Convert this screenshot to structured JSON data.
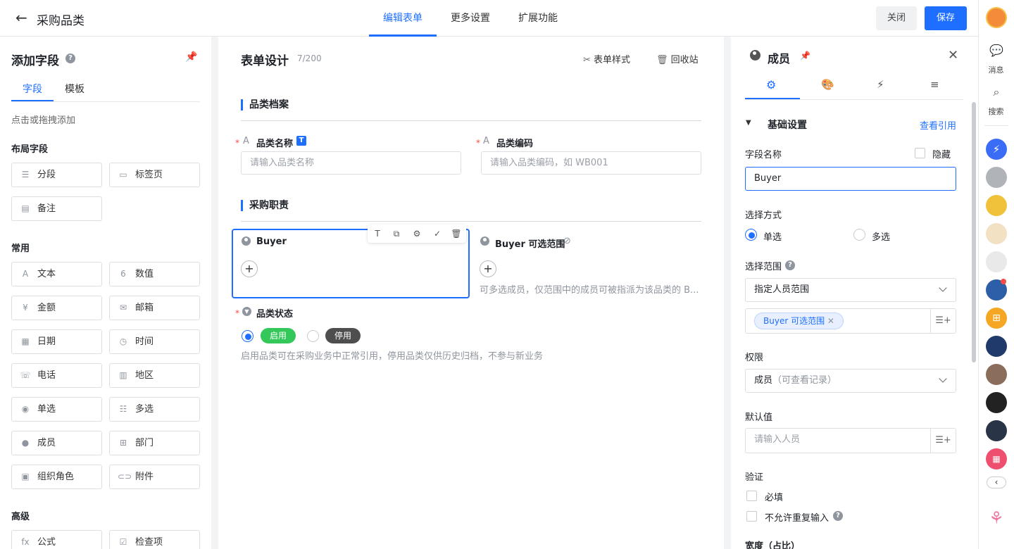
{
  "header": {
    "title": "采购品类",
    "tabs": [
      "编辑表单",
      "更多设置",
      "扩展功能"
    ],
    "close": "关闭",
    "save": "保存"
  },
  "left": {
    "title": "添加字段",
    "tabs": [
      "字段",
      "模板"
    ],
    "hint": "点击或拖拽添加",
    "layout_title": "布局字段",
    "layout_fields": [
      {
        "label": "分段",
        "icon": "section-icon"
      },
      {
        "label": "标签页",
        "icon": "tab-icon"
      },
      {
        "label": "备注",
        "icon": "note-icon"
      }
    ],
    "common_title": "常用",
    "common_fields": [
      {
        "label": "文本",
        "icon": "text-icon"
      },
      {
        "label": "数值",
        "icon": "number-icon"
      },
      {
        "label": "金额",
        "icon": "money-icon"
      },
      {
        "label": "邮箱",
        "icon": "mail-icon"
      },
      {
        "label": "日期",
        "icon": "calendar-icon"
      },
      {
        "label": "时间",
        "icon": "clock-icon"
      },
      {
        "label": "电话",
        "icon": "phone-icon"
      },
      {
        "label": "地区",
        "icon": "map-icon"
      },
      {
        "label": "单选",
        "icon": "single-select-icon"
      },
      {
        "label": "多选",
        "icon": "multi-select-icon"
      },
      {
        "label": "成员",
        "icon": "member-icon"
      },
      {
        "label": "部门",
        "icon": "department-icon"
      },
      {
        "label": "组织角色",
        "icon": "role-icon"
      },
      {
        "label": "附件",
        "icon": "attachment-icon"
      }
    ],
    "advanced_title": "高级",
    "advanced_fields": [
      {
        "label": "公式",
        "icon": "formula-icon"
      },
      {
        "label": "检查项",
        "icon": "checkbox-icon"
      }
    ]
  },
  "center": {
    "title": "表单设计",
    "count": "7/200",
    "tools": [
      "表单样式",
      "回收站"
    ],
    "section1": "品类档案",
    "f_name_label": "品类名称",
    "f_name_badge": "T",
    "f_name_placeholder": "请输入品类名称",
    "f_code_label": "品类编码",
    "f_code_placeholder": "请输入品类编码，如 WB001",
    "section2": "采购职责",
    "buyer_label": "Buyer",
    "scope_label": "Buyer 可选范围",
    "scope_desc": "可多选成员，仅范围中的成员可被指派为该品类的 B...",
    "status_label": "品类状态",
    "status_on": "启用",
    "status_off": "停用",
    "status_desc": "启用品类可在采购业务中正常引用，停用品类仅供历史归档，不参与新业务",
    "colors": {
      "accent": "#1e6fff",
      "on": "#34c759",
      "off": "#4e4e4e"
    }
  },
  "right": {
    "title": "成员",
    "basic": "基础设置",
    "refs": "查看引用",
    "field_name_label": "字段名称",
    "hide": "隐藏",
    "field_name_value": "Buyer",
    "mode_label": "选择方式",
    "mode_single": "单选",
    "mode_multi": "多选",
    "range_label": "选择范围",
    "range_value": "指定人员范围",
    "range_tag": "Buyer 可选范围",
    "perm_label": "权限",
    "perm_value": "成员",
    "perm_hint": "（可查看记录）",
    "default_label": "默认值",
    "default_placeholder": "请输入人员",
    "valid_label": "验证",
    "required": "必填",
    "no_dup": "不允许重复输入",
    "width_label": "宽度（占比）"
  },
  "side": {
    "messages": "消息",
    "search": "搜索"
  }
}
